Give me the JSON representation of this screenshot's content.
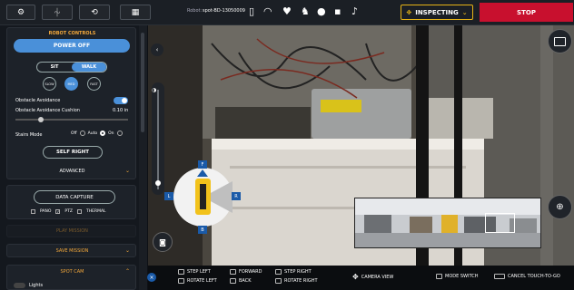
{
  "topbar": {
    "buttons": [
      {
        "icon": "gear-icon",
        "glyph": "⚙"
      },
      {
        "icon": "payload-icon",
        "glyph": "⏆"
      },
      {
        "icon": "history-icon",
        "glyph": "⟲"
      },
      {
        "icon": "keyboard-icon",
        "glyph": "▦"
      }
    ],
    "robot_label": "Robot:",
    "robot_name": "spot-BD-13050009",
    "inspect_label": "INSPECTING",
    "stop_label": "STOP"
  },
  "robot_controls": {
    "title": "ROBOT CONTROLS",
    "power_label": "POWER OFF",
    "sit_label": "SIT",
    "walk_label": "WALK",
    "speeds": [
      "SLOW",
      "MED",
      "FAST"
    ],
    "obstacle_avoidance_label": "Obstacle Avoidance",
    "obstacle_cushion_label": "Obstacle Avoidance Cushion",
    "obstacle_cushion_value": "0.10 in",
    "stairs_mode_label": "Stairs Mode",
    "stairs_options": [
      "Off",
      "Auto",
      "On"
    ],
    "self_right_label": "SELF RIGHT",
    "advanced_label": "ADVANCED"
  },
  "data_capture": {
    "button_label": "DATA CAPTURE",
    "options": [
      {
        "label": "PANO",
        "checked": false
      },
      {
        "label": "PTZ",
        "checked": true
      },
      {
        "label": "THERMAL",
        "checked": false
      }
    ]
  },
  "play_mission_label": "PLAY MISSION",
  "save_mission_label": "SAVE MISSION",
  "spot_cam_label": "SPOT CAM",
  "lights_label": "Lights",
  "compass": {
    "F": "F",
    "L": "L",
    "R": "R",
    "B": "B"
  },
  "hints": [
    {
      "keys": "Q",
      "label": "STEP LEFT"
    },
    {
      "keys": "A",
      "label": "ROTATE LEFT"
    },
    {
      "keys": "W",
      "label": "FORWARD"
    },
    {
      "keys": "S",
      "label": "BACK"
    },
    {
      "keys": "E",
      "label": "STEP RIGHT"
    },
    {
      "keys": "D",
      "label": "ROTATE RIGHT"
    },
    {
      "keys": "",
      "label": "CAMERA VIEW"
    },
    {
      "keys": "",
      "label": "MODE SWITCH"
    },
    {
      "keys": "ESC",
      "label": "CANCEL TOUCH-TO-GO"
    }
  ],
  "colors": {
    "accent": "#f3a83b",
    "power": "#4a90d9",
    "stop": "#c8102e",
    "inspect_border": "#e7b416"
  }
}
